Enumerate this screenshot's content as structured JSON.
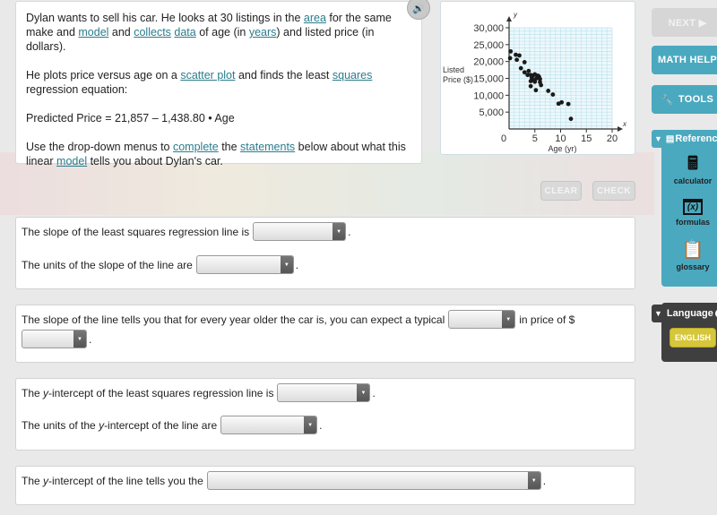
{
  "problem": {
    "paragraphs": [
      [
        {
          "text": "Dylan wants to sell his car. He looks at 30 listings in the "
        },
        {
          "text": "area",
          "link": true
        },
        {
          "text": " for the same make and "
        },
        {
          "text": "model",
          "link": true
        },
        {
          "text": " and "
        },
        {
          "text": "collects",
          "link": true
        },
        {
          "text": " "
        },
        {
          "text": "data",
          "link": true
        },
        {
          "text": " of age (in "
        },
        {
          "text": "years",
          "link": true
        },
        {
          "text": ") and listed price (in dollars)."
        }
      ],
      [
        {
          "text": "He plots price versus age on a "
        },
        {
          "text": "scatter plot",
          "link": true
        },
        {
          "text": " and finds the least "
        },
        {
          "text": "squares",
          "link": true
        },
        {
          "text": " regression equation:"
        }
      ],
      [
        {
          "text": "Predicted Price = 21,857 – 1,438.80 • Age"
        }
      ],
      [
        {
          "text": "Use the drop-down menus to "
        },
        {
          "text": "complete",
          "link": true
        },
        {
          "text": " the "
        },
        {
          "text": "statements",
          "link": true
        },
        {
          "text": " below about what this linear "
        },
        {
          "text": "model",
          "link": true
        },
        {
          "text": " tells you about Dylan's car."
        }
      ]
    ],
    "audio_icon": "speaker-icon"
  },
  "chart_data": {
    "type": "scatter",
    "title": "",
    "xlabel": "Age (yr)",
    "ylabel": "Listed Price ($)",
    "x_axis_letter": "x",
    "y_axis_letter": "y",
    "xlim": [
      0,
      20
    ],
    "ylim": [
      0,
      30000
    ],
    "x_ticks": [
      0,
      5,
      10,
      15,
      20
    ],
    "y_ticks": [
      5000,
      10000,
      15000,
      20000,
      25000,
      30000
    ],
    "x_tick_labels": [
      "0",
      "5",
      "10",
      "15",
      "20"
    ],
    "y_tick_labels": [
      "5,000",
      "10,000",
      "15,000",
      "20,000",
      "25,000",
      "30,000"
    ],
    "grid": true,
    "points": [
      [
        0.3,
        23000
      ],
      [
        0.2,
        21000
      ],
      [
        1.3,
        22000
      ],
      [
        2.0,
        21800
      ],
      [
        1.5,
        20500
      ],
      [
        3.0,
        19800
      ],
      [
        2.3,
        18000
      ],
      [
        3.0,
        16800
      ],
      [
        3.8,
        17200
      ],
      [
        3.6,
        16000
      ],
      [
        4.2,
        16000
      ],
      [
        4.6,
        15800
      ],
      [
        5.0,
        16200
      ],
      [
        5.6,
        15800
      ],
      [
        4.4,
        15200
      ],
      [
        4.8,
        14400
      ],
      [
        5.3,
        15000
      ],
      [
        5.8,
        15500
      ],
      [
        6.0,
        14800
      ],
      [
        4.2,
        14200
      ],
      [
        5.0,
        14000
      ],
      [
        6.0,
        13900
      ],
      [
        6.2,
        13000
      ],
      [
        4.2,
        12700
      ],
      [
        5.2,
        11500
      ],
      [
        7.6,
        11300
      ],
      [
        8.5,
        10200
      ],
      [
        9.6,
        7500
      ],
      [
        10.2,
        7900
      ],
      [
        11.5,
        7400
      ],
      [
        12.0,
        3000
      ]
    ]
  },
  "actions": {
    "clear_label": "CLEAR",
    "check_label": "CHECK"
  },
  "questions": [
    {
      "lines": [
        {
          "before": "The slope of the least squares regression line is",
          "after": "."
        },
        {
          "before": "The units of the slope of the line are",
          "after": "."
        }
      ]
    },
    {
      "lines": [
        {
          "before": "The slope of the line tells you that for every year older the car is, you can expect a typical",
          "after": "in price of $"
        },
        {
          "before": "",
          "after": "."
        }
      ]
    },
    {
      "lines": [
        {
          "before_pre": "The ",
          "before_italic": "y",
          "before": "-intercept of the least squares regression line is",
          "after": "."
        },
        {
          "before_pre": "The units of the ",
          "before_italic": "y",
          "before": "-intercept of the line are",
          "after": "."
        }
      ]
    },
    {
      "lines": [
        {
          "before_pre": "The ",
          "before_italic": "y",
          "before": "-intercept of the line tells you the",
          "after": "."
        }
      ]
    }
  ],
  "dropdowns": {
    "selected_value": ""
  },
  "sidebar": {
    "next_label": "NEXT ▶",
    "math_help_label": "MATH HELP",
    "tools_label": "TOOLS",
    "tools_icon": "wrench-icon",
    "reference_label": "Reference",
    "reference_items": [
      {
        "label": "calculator",
        "icon": "calculator-icon"
      },
      {
        "label": "formulas",
        "icon": "formulas-icon"
      },
      {
        "label": "glossary",
        "icon": "clipboard-icon"
      }
    ],
    "language_label": "Language",
    "english_label": "ENGLISH"
  },
  "colors": {
    "accent": "#4aa9bf",
    "link": "#2a7c8c",
    "language_button": "#d6c63a",
    "grid": "#bfe3ee"
  }
}
